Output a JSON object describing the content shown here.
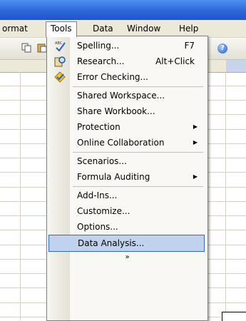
{
  "menubar": {
    "items": [
      {
        "label": "ormat"
      },
      {
        "label": "Tools"
      },
      {
        "label": "Data"
      },
      {
        "label": "Window"
      },
      {
        "label": "Help"
      }
    ]
  },
  "tools_menu": {
    "items": [
      {
        "label": "Spelling...",
        "shortcut": "F7",
        "icon": "spelling-icon"
      },
      {
        "label": "Research...",
        "shortcut": "Alt+Click",
        "icon": "research-icon"
      },
      {
        "label": "Error Checking...",
        "shortcut": "",
        "icon": "error-checking-icon"
      },
      {
        "label": "Shared Workspace...",
        "shortcut": ""
      },
      {
        "label": "Share Workbook...",
        "shortcut": ""
      },
      {
        "label": "Protection",
        "submenu": true
      },
      {
        "label": "Online Collaboration",
        "submenu": true
      },
      {
        "label": "Scenarios...",
        "shortcut": ""
      },
      {
        "label": "Formula Auditing",
        "submenu": true
      },
      {
        "label": "Add-Ins...",
        "shortcut": ""
      },
      {
        "label": "Customize...",
        "shortcut": ""
      },
      {
        "label": "Options...",
        "shortcut": ""
      },
      {
        "label": "Data Analysis...",
        "shortcut": "",
        "selected": true
      }
    ],
    "expand_glyph": "»"
  },
  "toolbar": {
    "help_glyph": "?"
  },
  "colors": {
    "accent": "#316ac5",
    "selection": "#c1d2ee",
    "menubar": "#ece9d8"
  }
}
